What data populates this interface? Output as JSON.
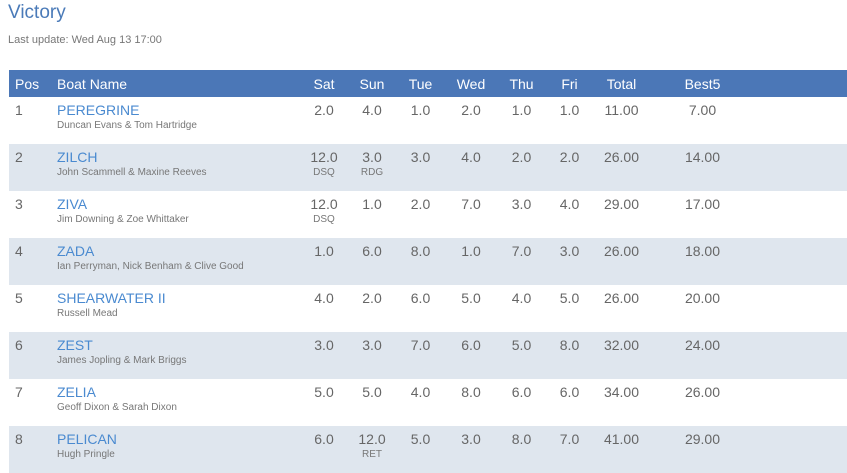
{
  "page": {
    "title": "Victory",
    "last_update": "Last update: Wed Aug 13 17:00"
  },
  "table": {
    "headers": {
      "pos": "Pos",
      "boat": "Boat Name",
      "sat": "Sat",
      "sun": "Sun",
      "tue": "Tue",
      "wed": "Wed",
      "thu": "Thu",
      "fri": "Fri",
      "total": "Total",
      "best5": "Best5"
    },
    "rows": [
      {
        "pos": "1",
        "boat": "PEREGRINE",
        "crew": "Duncan Evans & Tom Hartridge",
        "scores": [
          {
            "v": "2.0",
            "c": ""
          },
          {
            "v": "4.0",
            "c": ""
          },
          {
            "v": "1.0",
            "c": ""
          },
          {
            "v": "2.0",
            "c": ""
          },
          {
            "v": "1.0",
            "c": ""
          },
          {
            "v": "1.0",
            "c": ""
          }
        ],
        "total": "11.00",
        "best5": "7.00"
      },
      {
        "pos": "2",
        "boat": "ZILCH",
        "crew": "John Scammell & Maxine Reeves",
        "scores": [
          {
            "v": "12.0",
            "c": "DSQ"
          },
          {
            "v": "3.0",
            "c": "RDG"
          },
          {
            "v": "3.0",
            "c": ""
          },
          {
            "v": "4.0",
            "c": ""
          },
          {
            "v": "2.0",
            "c": ""
          },
          {
            "v": "2.0",
            "c": ""
          }
        ],
        "total": "26.00",
        "best5": "14.00"
      },
      {
        "pos": "3",
        "boat": "ZIVA",
        "crew": "Jim Downing & Zoe Whittaker",
        "scores": [
          {
            "v": "12.0",
            "c": "DSQ"
          },
          {
            "v": "1.0",
            "c": ""
          },
          {
            "v": "2.0",
            "c": ""
          },
          {
            "v": "7.0",
            "c": ""
          },
          {
            "v": "3.0",
            "c": ""
          },
          {
            "v": "4.0",
            "c": ""
          }
        ],
        "total": "29.00",
        "best5": "17.00"
      },
      {
        "pos": "4",
        "boat": "ZADA",
        "crew": "Ian Perryman, Nick Benham & Clive Good",
        "scores": [
          {
            "v": "1.0",
            "c": ""
          },
          {
            "v": "6.0",
            "c": ""
          },
          {
            "v": "8.0",
            "c": ""
          },
          {
            "v": "1.0",
            "c": ""
          },
          {
            "v": "7.0",
            "c": ""
          },
          {
            "v": "3.0",
            "c": ""
          }
        ],
        "total": "26.00",
        "best5": "18.00"
      },
      {
        "pos": "5",
        "boat": "SHEARWATER II",
        "crew": "Russell Mead",
        "scores": [
          {
            "v": "4.0",
            "c": ""
          },
          {
            "v": "2.0",
            "c": ""
          },
          {
            "v": "6.0",
            "c": ""
          },
          {
            "v": "5.0",
            "c": ""
          },
          {
            "v": "4.0",
            "c": ""
          },
          {
            "v": "5.0",
            "c": ""
          }
        ],
        "total": "26.00",
        "best5": "20.00"
      },
      {
        "pos": "6",
        "boat": "ZEST",
        "crew": "James Jopling & Mark Briggs",
        "scores": [
          {
            "v": "3.0",
            "c": ""
          },
          {
            "v": "3.0",
            "c": ""
          },
          {
            "v": "7.0",
            "c": ""
          },
          {
            "v": "6.0",
            "c": ""
          },
          {
            "v": "5.0",
            "c": ""
          },
          {
            "v": "8.0",
            "c": ""
          }
        ],
        "total": "32.00",
        "best5": "24.00"
      },
      {
        "pos": "7",
        "boat": "ZELIA",
        "crew": "Geoff Dixon & Sarah Dixon",
        "scores": [
          {
            "v": "5.0",
            "c": ""
          },
          {
            "v": "5.0",
            "c": ""
          },
          {
            "v": "4.0",
            "c": ""
          },
          {
            "v": "8.0",
            "c": ""
          },
          {
            "v": "6.0",
            "c": ""
          },
          {
            "v": "6.0",
            "c": ""
          }
        ],
        "total": "34.00",
        "best5": "26.00"
      },
      {
        "pos": "8",
        "boat": "PELICAN",
        "crew": "Hugh Pringle",
        "scores": [
          {
            "v": "6.0",
            "c": ""
          },
          {
            "v": "12.0",
            "c": "RET"
          },
          {
            "v": "5.0",
            "c": ""
          },
          {
            "v": "3.0",
            "c": ""
          },
          {
            "v": "8.0",
            "c": ""
          },
          {
            "v": "7.0",
            "c": ""
          }
        ],
        "total": "41.00",
        "best5": "29.00"
      }
    ]
  },
  "colors": {
    "header_bg": "#4b77b7",
    "title": "#4a7ab8",
    "link": "#4a8ad0",
    "row_alt": "#dfe6ee"
  }
}
